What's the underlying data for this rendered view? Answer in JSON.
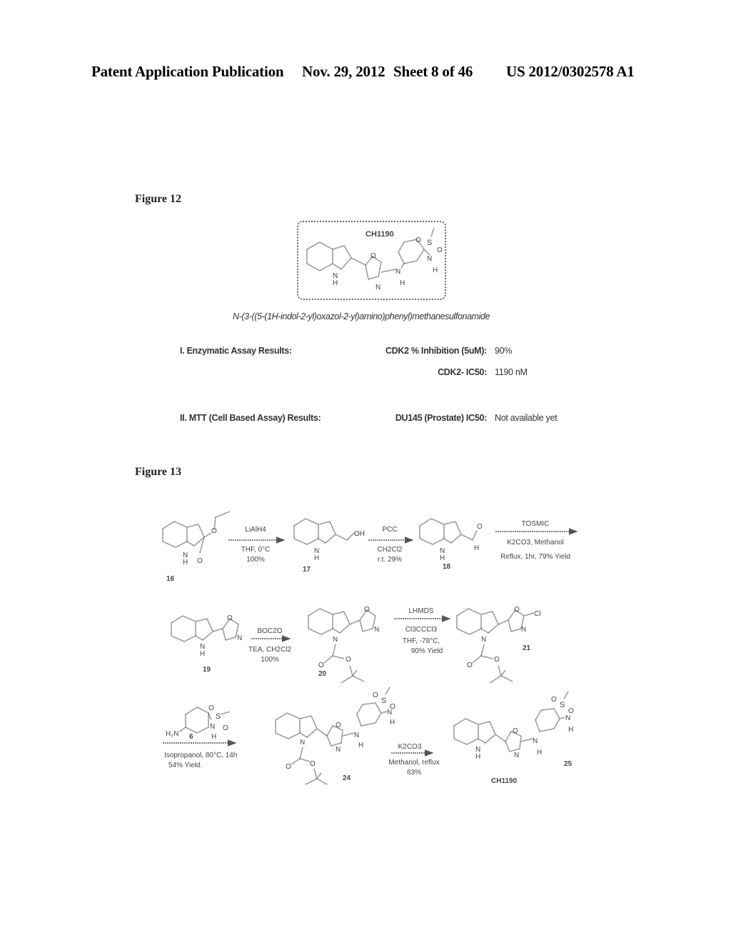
{
  "header": {
    "publication_type": "Patent Application Publication",
    "date": "Nov. 29, 2012",
    "sheet": "Sheet 8 of 46",
    "patent_number": "US 2012/0302578 A1"
  },
  "figure12": {
    "label": "Figure 12",
    "compound_name": "CH1190",
    "iupac_name": "N-(3-((5-(1H-indol-2-yl)oxazol-2-yl)amino)phenyl)methanesulfonamide",
    "results": [
      {
        "section": "I. Enzymatic Assay Results:",
        "label": "CDK2 % Inhibition (5uM):",
        "value": "90%"
      },
      {
        "section": "",
        "label": "CDK2- IC50:",
        "value": "1190 nM"
      },
      {
        "section": "II. MTT (Cell Based Assay) Results:",
        "label": "DU145 (Prostate) IC50:",
        "value": "Not available yet"
      }
    ]
  },
  "figure13": {
    "label": "Figure 13",
    "compounds": {
      "c16": "16",
      "c17": "17",
      "c18": "18",
      "c19": "19",
      "c20": "20",
      "c21": "21",
      "c6": "6",
      "c24": "24",
      "c25": "25",
      "ch1190": "CH1190"
    },
    "reactions": [
      {
        "reagent": "LiAlH4",
        "conditions": [
          "THF, 0°C",
          "100%"
        ]
      },
      {
        "reagent": "PCC",
        "conditions": [
          "CH2Cl2",
          "r.t. 29%"
        ]
      },
      {
        "reagent": "TOSMIC",
        "conditions": [
          "K2CO3, Methanol",
          "Reflux, 1hr, 79% Yield"
        ]
      },
      {
        "reagent": "BOC2O",
        "conditions": [
          "TEA, CH2Cl2",
          "100%"
        ]
      },
      {
        "reagent": "LHMDS",
        "conditions": [
          "Cl3CCCl3",
          "THF, -78°C,",
          "90% Yield"
        ]
      },
      {
        "reagent": "",
        "conditions": [
          "Isopropanol, 80°C, 14h",
          "54% Yield."
        ]
      },
      {
        "reagent": "K2CO3",
        "conditions": [
          "Methanol, reflux",
          "63%"
        ]
      }
    ],
    "atoms": {
      "N": "N",
      "H": "H",
      "O": "O",
      "S": "S",
      "OH": "OH",
      "Cl": "Cl",
      "H2N": "H₂N"
    }
  }
}
